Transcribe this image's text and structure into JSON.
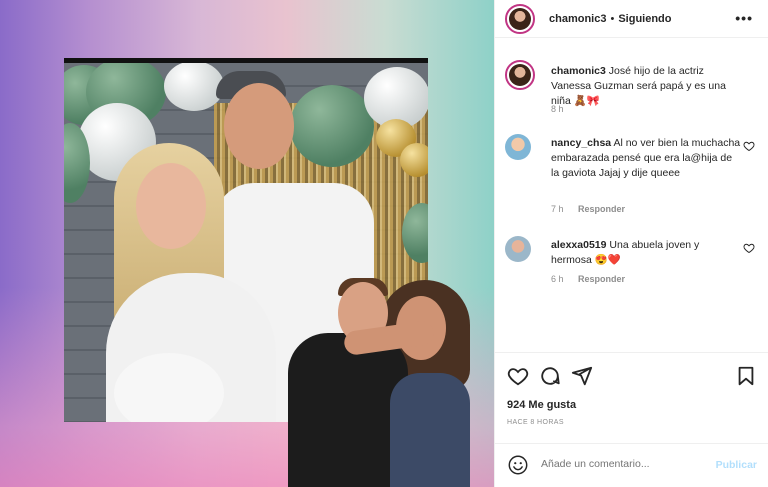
{
  "header": {
    "username": "chamonic3",
    "separator": "•",
    "follow_status": "Siguiendo",
    "more_icon": "more-horizontal-icon"
  },
  "caption": {
    "username": "chamonic3",
    "text": "José hijo de la actriz Vanessa Guzman será papá y es una niña 🧸🎀",
    "time": "8 h"
  },
  "comments": [
    {
      "username": "nancy_chsa",
      "text": "Al no ver bien la muchacha embarazada pensé que era la@hija de la gaviota Jajaj y dije queee",
      "time": "7 h",
      "reply": "Responder"
    },
    {
      "username": "alexxa0519",
      "text": "Una abuela joven y hermosa 😍❤️",
      "time": "6 h",
      "reply": "Responder"
    }
  ],
  "actions": {
    "like_icon": "heart-icon",
    "comment_icon": "comment-icon",
    "share_icon": "send-icon",
    "save_icon": "bookmark-icon",
    "likes": "924 Me gusta",
    "posted": "HACE 8 HORAS"
  },
  "add_comment": {
    "placeholder": "Añade un comentario...",
    "publish": "Publicar",
    "emoji_icon": "smile-icon"
  },
  "colors": {
    "story_ring": "#c13584",
    "publish_disabled": "#b2dffc",
    "muted_text": "#8e8e8e"
  }
}
